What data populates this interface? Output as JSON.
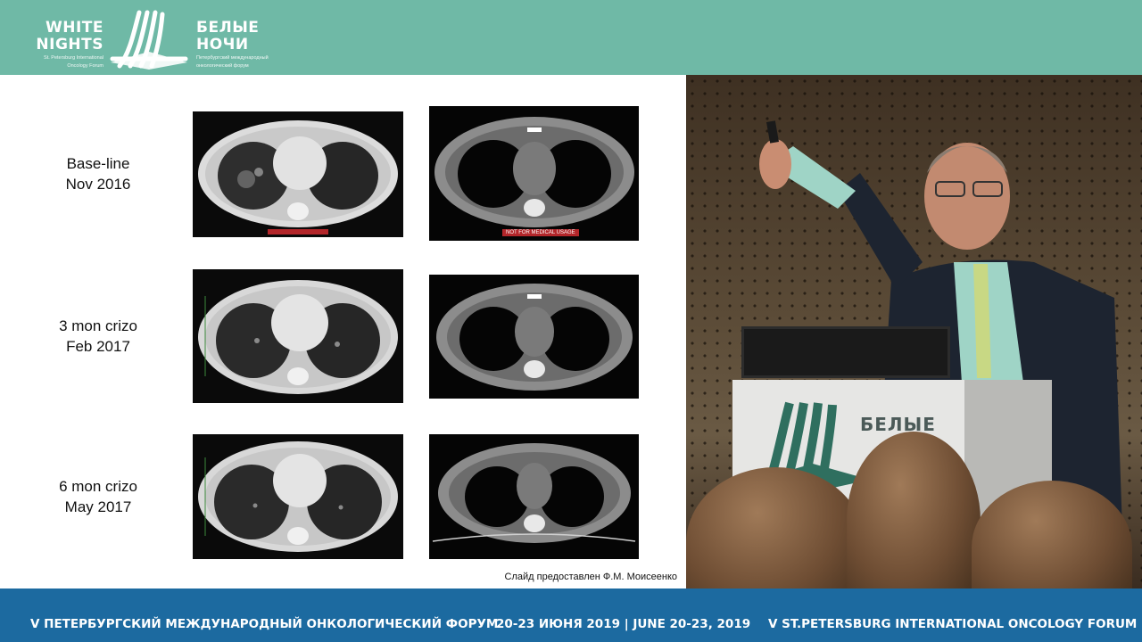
{
  "header": {
    "logo_en_line1": "WHITE",
    "logo_en_line2": "NIGHTS",
    "logo_en_sub1": "St. Petersburg International",
    "logo_en_sub2": "Oncology Forum",
    "logo_ru_line1": "БЕЛЫЕ",
    "logo_ru_line2": "НОЧИ",
    "logo_ru_sub1": "Петербургский международный",
    "logo_ru_sub2": "онкологический форум",
    "logo_icon": "white-nights-mark-icon"
  },
  "slide": {
    "rows": [
      {
        "line1": "Base-line",
        "line2": "Nov 2016"
      },
      {
        "line1": "3 mon crizo",
        "line2": "Feb 2017"
      },
      {
        "line1": "6 mon crizo",
        "line2": "May 2017"
      }
    ],
    "scan_watermark": "NOT FOR MEDICAL USAGE",
    "credit": "Слайд предоставлен Ф.М. Моисеенко"
  },
  "stage": {
    "podium_text": "БЕЛЫЕ"
  },
  "footer": {
    "left": "V ПЕТЕРБУРГСКИЙ МЕЖДУНАРОДНЫЙ ОНКОЛОГИЧЕСКИЙ ФОРУМ",
    "center": "20-23 ИЮНЯ 2019 | JUNE 20-23, 2019",
    "right": "V ST.PETERSBURG INTERNATIONAL ONCOLOGY FORUM"
  },
  "colors": {
    "header_teal": "#6fb9a6",
    "footer_blue": "#1c6aa0"
  }
}
